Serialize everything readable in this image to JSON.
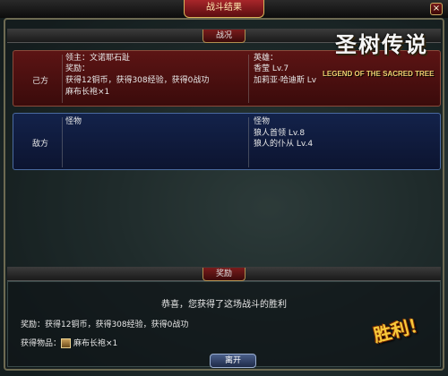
{
  "window": {
    "title": "战斗结果",
    "close_glyph": "×"
  },
  "battle_status": {
    "header": "战况"
  },
  "ally": {
    "label": "己方",
    "lord_line": "领主：文诺耶石趾",
    "reward_label": "奖励：",
    "reward_line": "获得12铜币，获得308经验，获得0战功",
    "item_line": "麻布长袍×1",
    "heroes_label": "英雄：",
    "heroes": [
      "香莹 Lv.7",
      "加莉亚·哈迪斯 Lv"
    ]
  },
  "enemy": {
    "label": "敌方",
    "monsters_label_left": "怪物",
    "monsters_label_right": "怪物",
    "monsters": [
      "狼人首领 Lv.8",
      "狼人的仆从 Lv.4"
    ]
  },
  "logo": {
    "title": "圣树传说",
    "subtitle": "LEGEND OF THE SACRED TREE"
  },
  "reward": {
    "header": "奖励",
    "congrats": "恭喜，您获得了这场战斗的胜利",
    "reward_line": "奖励：获得12铜币，获得308经验，获得0战功",
    "items_label": "获得物品：",
    "item_name": "麻布长袍×1",
    "item_icon": "robe-icon"
  },
  "leave_button": "离开",
  "victory_text": "胜利！"
}
